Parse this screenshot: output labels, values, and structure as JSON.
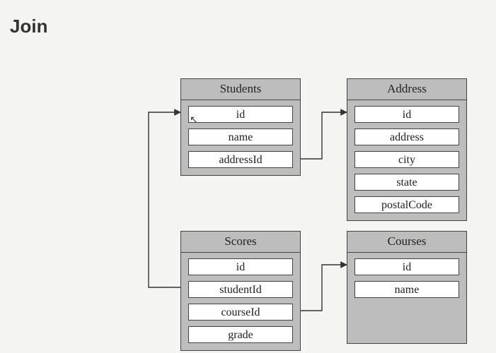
{
  "title": "Join",
  "tables": {
    "students": {
      "name": "Students",
      "fields": [
        "id",
        "name",
        "addressId"
      ]
    },
    "address": {
      "name": "Address",
      "fields": [
        "id",
        "address",
        "city",
        "state",
        "postalCode"
      ]
    },
    "scores": {
      "name": "Scores",
      "fields": [
        "id",
        "studentId",
        "courseId",
        "grade"
      ]
    },
    "courses": {
      "name": "Courses",
      "fields": [
        "id",
        "name"
      ]
    }
  },
  "relations": [
    {
      "from": "Students.addressId",
      "to": "Address.id"
    },
    {
      "from": "Scores.studentId",
      "to": "Students.id"
    },
    {
      "from": "Scores.courseId",
      "to": "Courses.id"
    }
  ]
}
